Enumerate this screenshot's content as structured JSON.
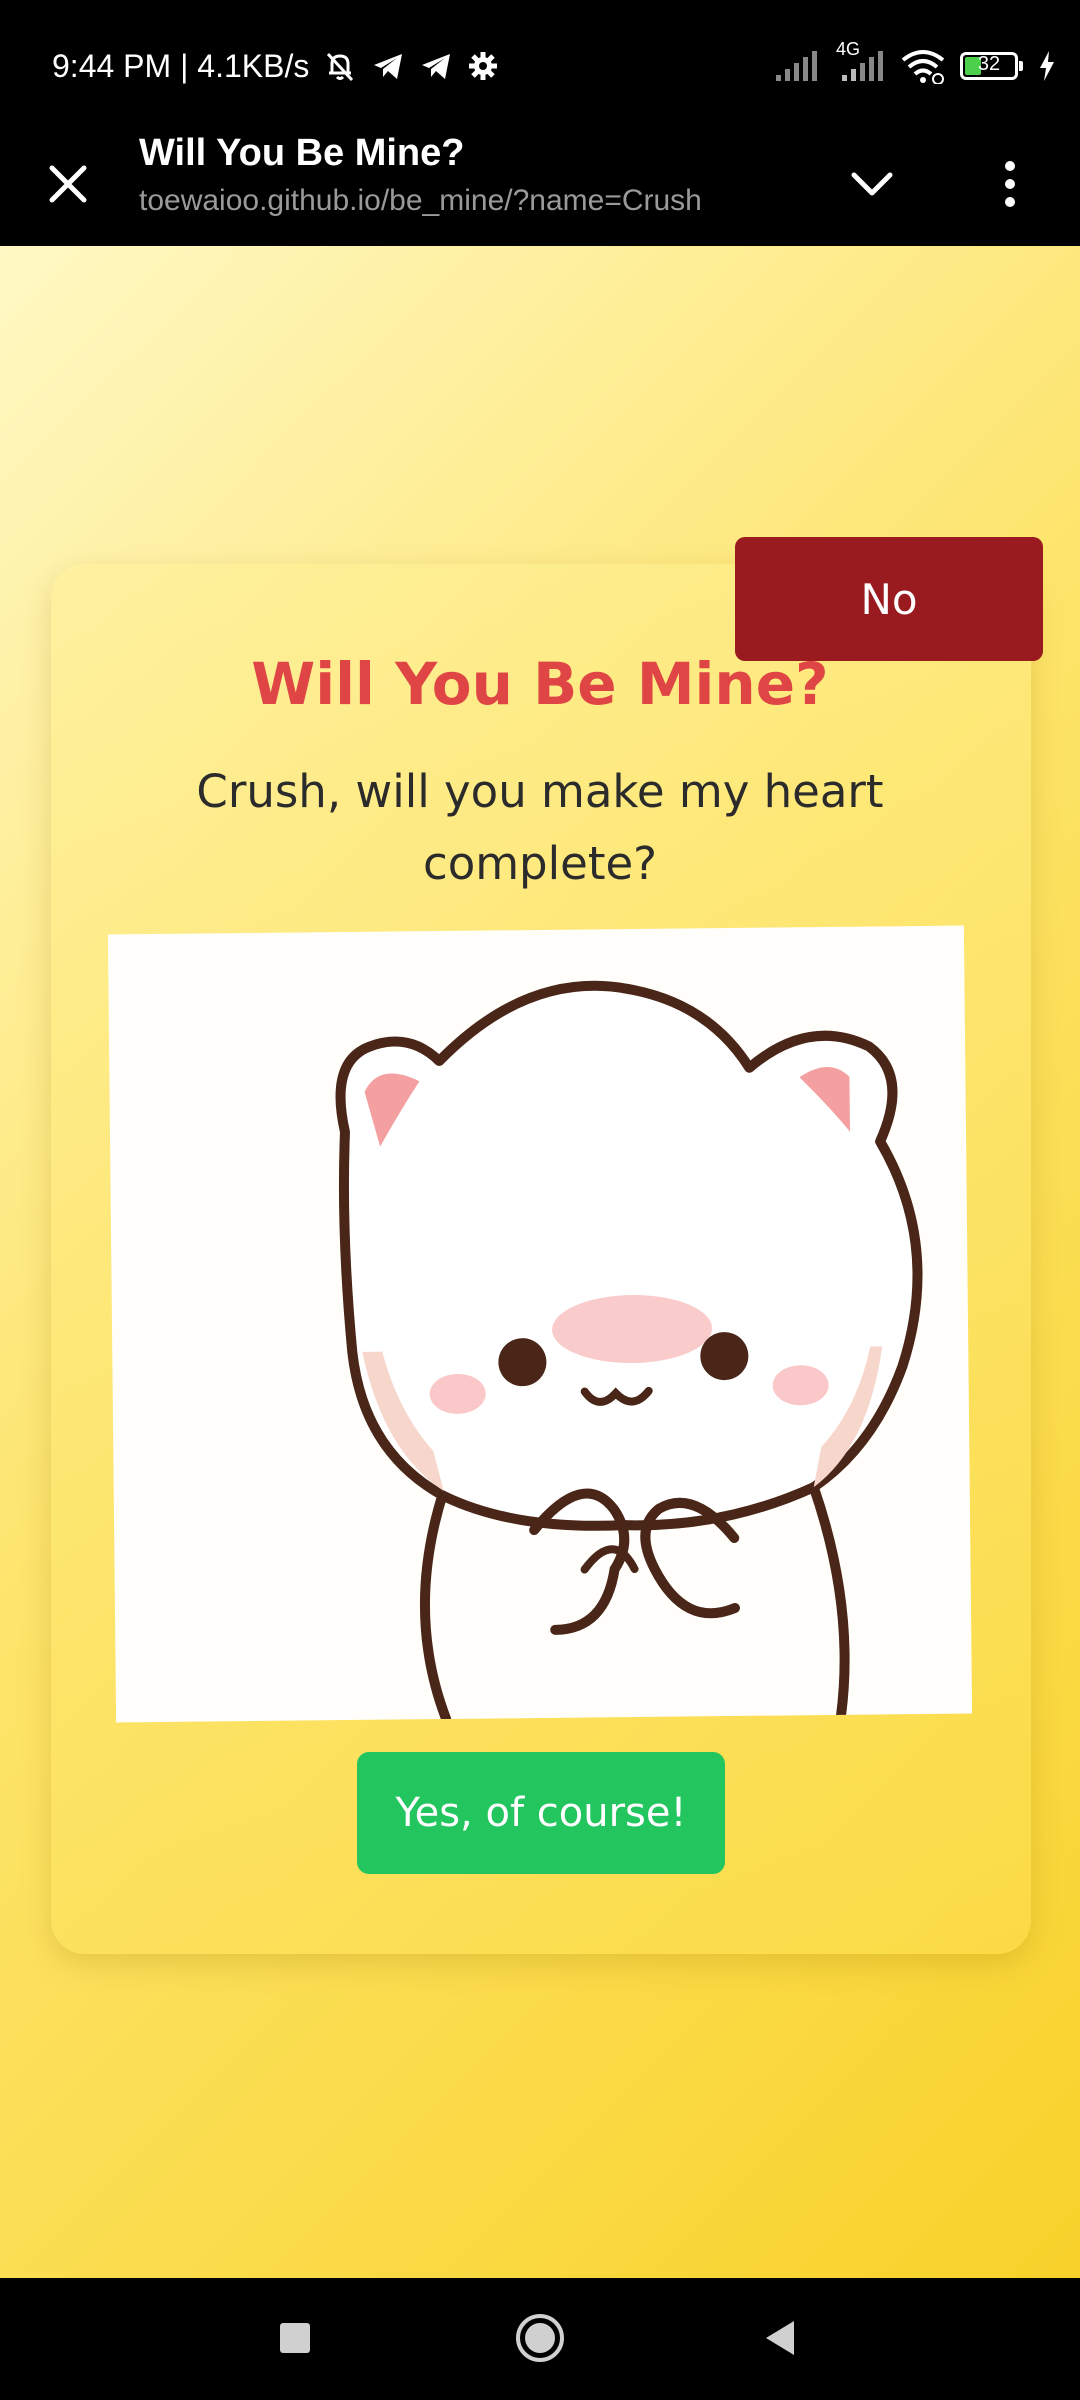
{
  "status_bar": {
    "time_speed": "9:44 PM | 4.1KB/s",
    "network_label": "4G",
    "battery_level": "32",
    "icons": [
      "mute-bell-icon",
      "telegram-icon",
      "telegram-icon",
      "settings-gear-icon",
      "signal-icon",
      "signal-4g-icon",
      "wifi-icon",
      "battery-icon",
      "charging-bolt-icon"
    ]
  },
  "browser": {
    "title": "Will You Be Mine?",
    "url": "toewaioo.github.io/be_mine/?name=Crush",
    "icons": [
      "close-icon",
      "chevron-down-icon",
      "more-vert-icon"
    ]
  },
  "page": {
    "heading": "Will You Be Mine?",
    "subtitle": "Crush, will you make my heart complete?",
    "image": "cat-illustration",
    "no_label": "No",
    "yes_label": "Yes, of course!",
    "colors": {
      "heading": "#e04545",
      "no_button": "#9a1b1f",
      "yes_button": "#22c55e",
      "background": "#fde46a"
    }
  },
  "nav_bar": {
    "icons": [
      "recents-square-icon",
      "home-circle-icon",
      "back-triangle-icon"
    ]
  }
}
